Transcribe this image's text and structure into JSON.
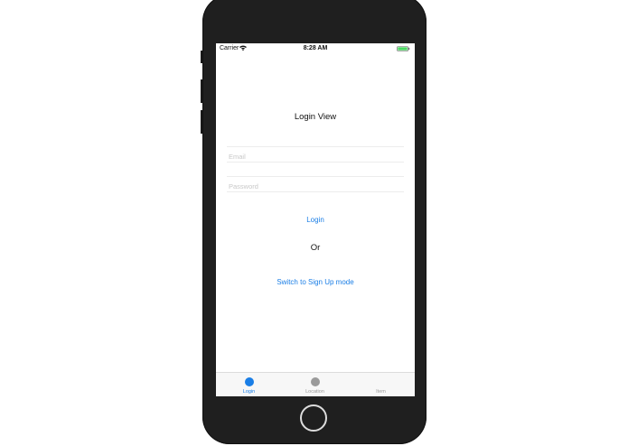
{
  "status_bar": {
    "carrier": "Carrier",
    "time": "8:28 AM"
  },
  "screen": {
    "title": "Login View",
    "email_placeholder": "Email",
    "password_placeholder": "Password",
    "login_label": "Login",
    "or_label": "Or",
    "switch_label": "Switch to Sign Up mode"
  },
  "tab_bar": {
    "tabs": [
      {
        "label": "Login",
        "color": "#1a7ee6",
        "active": true
      },
      {
        "label": "Location",
        "color": "#9a9a9a",
        "active": false
      },
      {
        "label": "Item",
        "color": "#9a9a9a",
        "active": false
      }
    ]
  },
  "colors": {
    "accent": "#1a7ee6",
    "device": "#1f1f1f",
    "inactive": "#9a9a9a"
  }
}
